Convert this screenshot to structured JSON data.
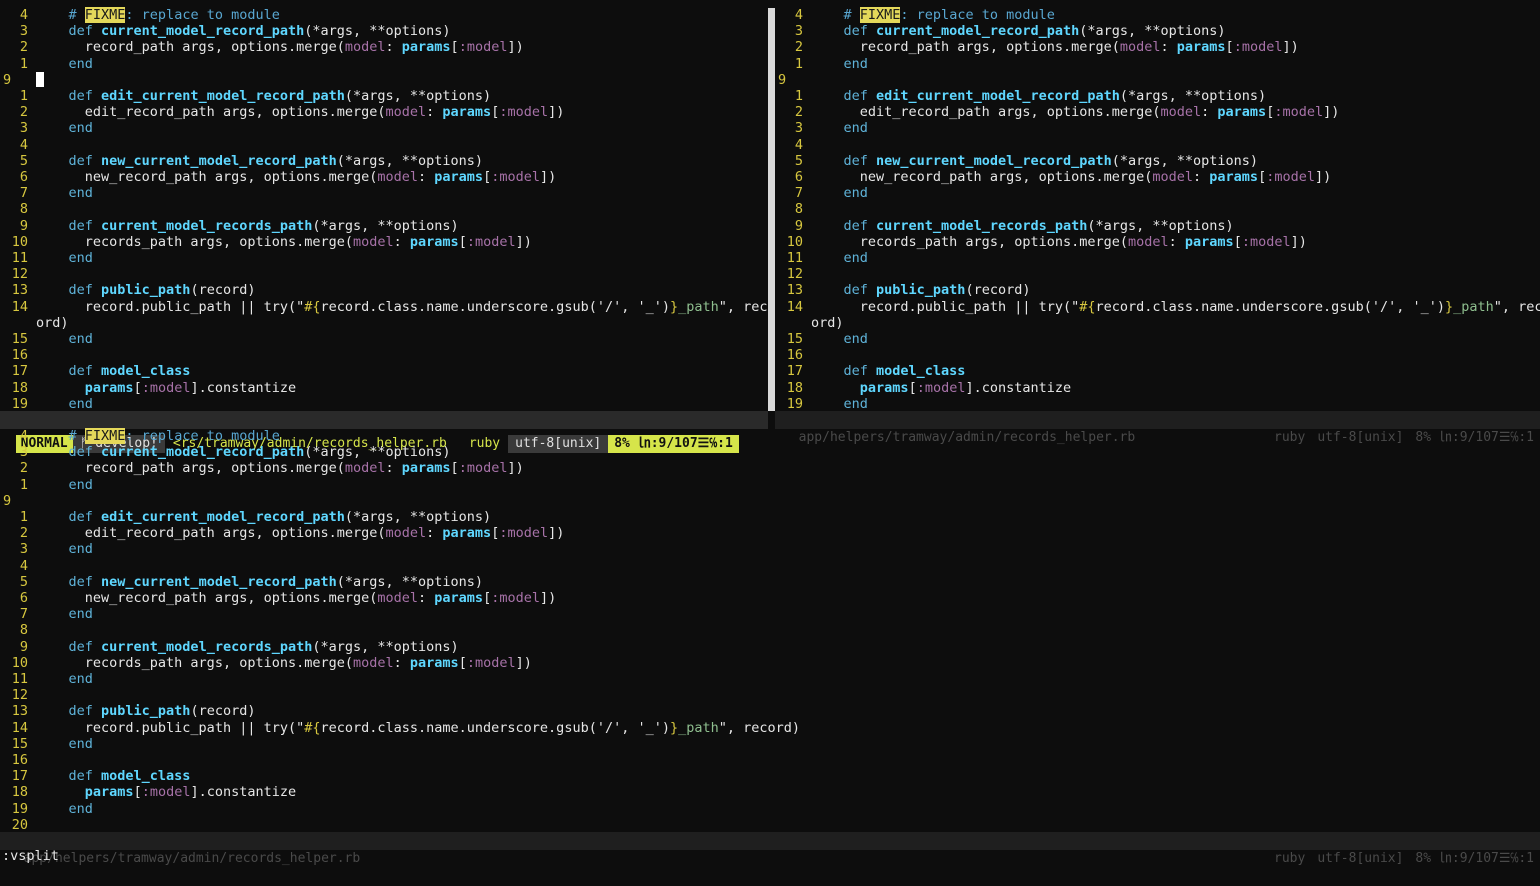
{
  "code_lines": [
    {
      "n": "4",
      "segs": [
        [
          "cmt",
          "# "
        ],
        [
          "fixme",
          "FIXME"
        ],
        [
          "cmt",
          ": replace to module"
        ]
      ]
    },
    {
      "n": "3",
      "segs": [
        [
          "kw",
          "def "
        ],
        [
          "fn",
          "current_model_record_path"
        ],
        [
          "txt",
          "(*args, **options)"
        ]
      ]
    },
    {
      "n": "2",
      "segs": [
        [
          "txt",
          "  record_path args, options.merge("
        ],
        [
          "sym",
          "model"
        ],
        [
          "txt",
          ": "
        ],
        [
          "fn",
          "params"
        ],
        [
          "txt",
          "["
        ],
        [
          "sym",
          ":model"
        ],
        [
          "txt",
          "])"
        ]
      ]
    },
    {
      "n": "1",
      "segs": [
        [
          "kw",
          "end"
        ]
      ]
    },
    {
      "n": "9",
      "cursor": true,
      "segs": []
    },
    {
      "n": "1",
      "segs": [
        [
          "kw",
          "def "
        ],
        [
          "fn",
          "edit_current_model_record_path"
        ],
        [
          "txt",
          "(*args, **options)"
        ]
      ]
    },
    {
      "n": "2",
      "segs": [
        [
          "txt",
          "  edit_record_path args, options.merge("
        ],
        [
          "sym",
          "model"
        ],
        [
          "txt",
          ": "
        ],
        [
          "fn",
          "params"
        ],
        [
          "txt",
          "["
        ],
        [
          "sym",
          ":model"
        ],
        [
          "txt",
          "])"
        ]
      ]
    },
    {
      "n": "3",
      "segs": [
        [
          "kw",
          "end"
        ]
      ]
    },
    {
      "n": "4",
      "segs": []
    },
    {
      "n": "5",
      "segs": [
        [
          "kw",
          "def "
        ],
        [
          "fn",
          "new_current_model_record_path"
        ],
        [
          "txt",
          "(*args, **options)"
        ]
      ]
    },
    {
      "n": "6",
      "segs": [
        [
          "txt",
          "  new_record_path args, options.merge("
        ],
        [
          "sym",
          "model"
        ],
        [
          "txt",
          ": "
        ],
        [
          "fn",
          "params"
        ],
        [
          "txt",
          "["
        ],
        [
          "sym",
          ":model"
        ],
        [
          "txt",
          "])"
        ]
      ]
    },
    {
      "n": "7",
      "segs": [
        [
          "kw",
          "end"
        ]
      ]
    },
    {
      "n": "8",
      "segs": []
    },
    {
      "n": "9",
      "segs": [
        [
          "kw",
          "def "
        ],
        [
          "fn",
          "current_model_records_path"
        ],
        [
          "txt",
          "(*args, **options)"
        ]
      ]
    },
    {
      "n": "10",
      "segs": [
        [
          "txt",
          "  records_path args, options.merge("
        ],
        [
          "sym",
          "model"
        ],
        [
          "txt",
          ": "
        ],
        [
          "fn",
          "params"
        ],
        [
          "txt",
          "["
        ],
        [
          "sym",
          ":model"
        ],
        [
          "txt",
          "])"
        ]
      ]
    },
    {
      "n": "11",
      "segs": [
        [
          "kw",
          "end"
        ]
      ]
    },
    {
      "n": "12",
      "segs": []
    },
    {
      "n": "13",
      "segs": [
        [
          "kw",
          "def "
        ],
        [
          "fn",
          "public_path"
        ],
        [
          "txt",
          "(record)"
        ]
      ]
    },
    {
      "n": "14",
      "segs": [
        [
          "txt",
          "  record.public_path || try(\""
        ],
        [
          "interp",
          "#{"
        ],
        [
          "txt",
          "record.class.name.underscore.gsub('/', '_')"
        ],
        [
          "interp",
          "}"
        ],
        [
          "str",
          "_path"
        ],
        [
          "txt",
          "\", record)"
        ]
      ]
    },
    {
      "n": "15",
      "segs": [
        [
          "kw",
          "end"
        ]
      ]
    },
    {
      "n": "16",
      "segs": []
    },
    {
      "n": "17",
      "segs": [
        [
          "kw",
          "def "
        ],
        [
          "fn",
          "model_class"
        ]
      ]
    },
    {
      "n": "18",
      "segs": [
        [
          "txt",
          "  "
        ],
        [
          "fn",
          "params"
        ],
        [
          "txt",
          "["
        ],
        [
          "sym",
          ":model"
        ],
        [
          "txt",
          "].constantize"
        ]
      ]
    },
    {
      "n": "19",
      "segs": [
        [
          "kw",
          "end"
        ]
      ]
    },
    {
      "n": "20",
      "segs": []
    }
  ],
  "wrap_remainder": "ord)",
  "status_active": {
    "mode": "NORMAL",
    "branch": "ᚠ develop!",
    "file": "<rs/tramway/admin/records_helper.rb",
    "filetype": "ruby",
    "encoding": "utf-8[unix]",
    "position": "8% ㏑:9/107☰℅:1"
  },
  "status_right_inactive": {
    "file": "app/helpers/tramway/admin/records_helper.rb",
    "filetype": "ruby",
    "encoding": "utf-8[unix]",
    "position": "8% ㏑:9/107☰℅:1"
  },
  "status_bottom_inactive": {
    "file": "app/helpers/tramway/admin/records_helper.rb",
    "filetype": "ruby",
    "encoding": "utf-8[unix]",
    "position": "8% ㏑:9/107☰℅:1"
  },
  "command_line": ":vsplit"
}
